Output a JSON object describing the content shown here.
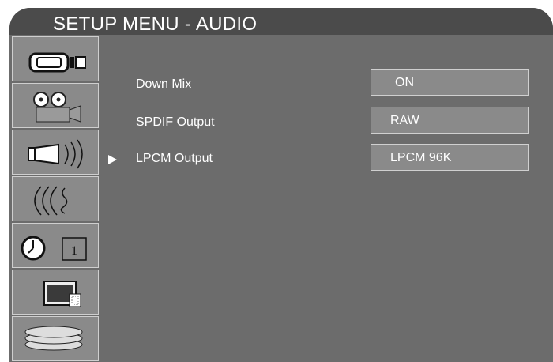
{
  "title": "SETUP MENU - AUDIO",
  "sidebar": {
    "tabs": [
      {
        "name": "general-setup-icon"
      },
      {
        "name": "video-setup-icon"
      },
      {
        "name": "audio-setup-icon"
      },
      {
        "name": "surround-icon"
      },
      {
        "name": "timer-icon",
        "digit": "1"
      },
      {
        "name": "tv-display-icon"
      },
      {
        "name": "disc-icon"
      }
    ]
  },
  "menu": {
    "items": [
      {
        "label": "Down Mix",
        "value": "ON"
      },
      {
        "label": "SPDIF Output",
        "value": "RAW"
      },
      {
        "label": "LPCM Output",
        "value": "LPCM 96K"
      }
    ],
    "selected_index": 2,
    "selection_marker": "▶"
  },
  "colors": {
    "panel": "#6c6c6c",
    "title_bar": "#4b4b4b",
    "tab": "#8a8a8a",
    "value_box": "#8a8a8a",
    "text": "#ffffff"
  }
}
